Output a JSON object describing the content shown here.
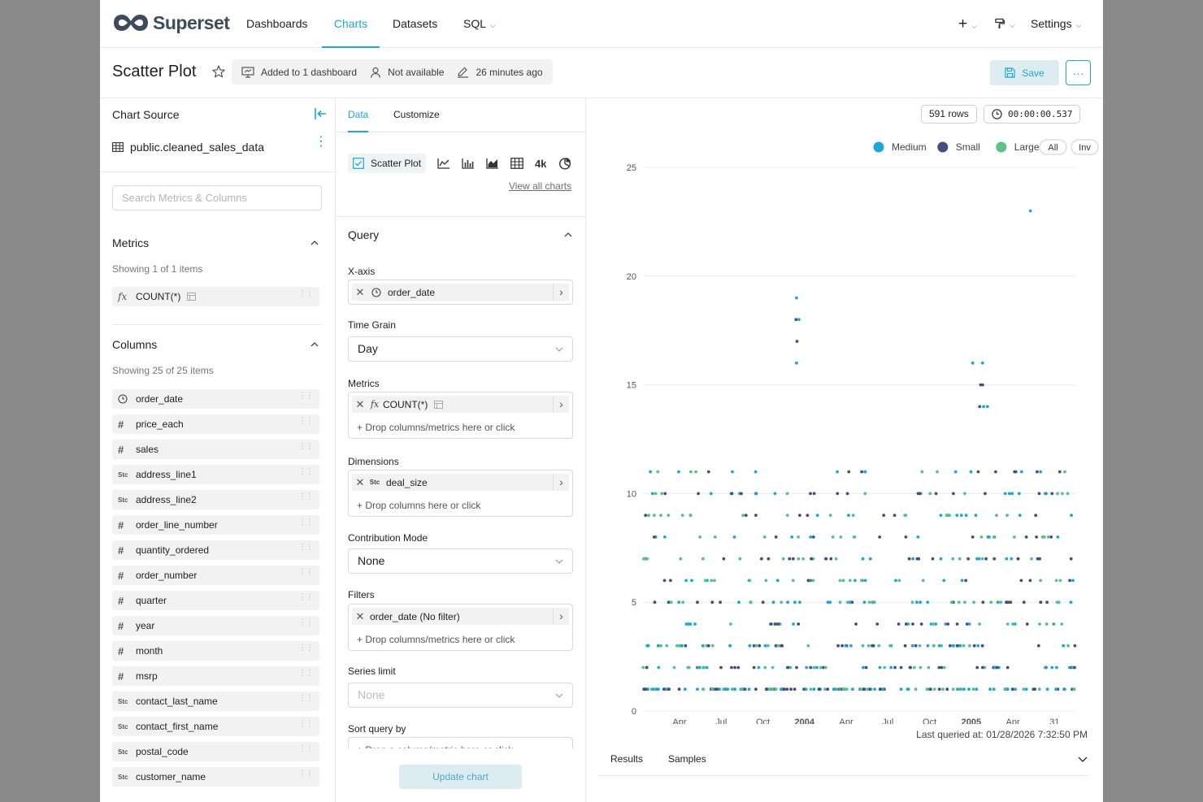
{
  "app": {
    "brand": "Superset",
    "accent": "#20a7c9"
  },
  "nav": {
    "items": [
      {
        "label": "Dashboards",
        "active": false
      },
      {
        "label": "Charts",
        "active": true
      },
      {
        "label": "Datasets",
        "active": false
      },
      {
        "label": "SQL",
        "active": false
      }
    ],
    "settings_label": "Settings"
  },
  "header": {
    "title": "Scatter Plot",
    "meta": {
      "dashboards": "Added to 1 dashboard",
      "owner": "Not available",
      "modified": "26 minutes ago"
    },
    "save_label": "Save",
    "more_label": "···"
  },
  "left": {
    "source_label": "Chart Source",
    "dataset": "public.cleaned_sales_data",
    "search_placeholder": "Search Metrics & Columns",
    "metrics": {
      "title": "Metrics",
      "showing": "Showing 1 of 1 items",
      "items": [
        {
          "label": "COUNT(*)",
          "type": "fx"
        }
      ]
    },
    "columns": {
      "title": "Columns",
      "showing": "Showing 25 of 25 items",
      "items": [
        {
          "label": "order_date",
          "type": "time"
        },
        {
          "label": "price_each",
          "type": "num"
        },
        {
          "label": "sales",
          "type": "num"
        },
        {
          "label": "address_line1",
          "type": "str"
        },
        {
          "label": "address_line2",
          "type": "str"
        },
        {
          "label": "order_line_number",
          "type": "num"
        },
        {
          "label": "quantity_ordered",
          "type": "num"
        },
        {
          "label": "order_number",
          "type": "num"
        },
        {
          "label": "quarter",
          "type": "num"
        },
        {
          "label": "year",
          "type": "num"
        },
        {
          "label": "month",
          "type": "num"
        },
        {
          "label": "msrp",
          "type": "num"
        },
        {
          "label": "contact_last_name",
          "type": "str"
        },
        {
          "label": "contact_first_name",
          "type": "str"
        },
        {
          "label": "postal_code",
          "type": "str"
        },
        {
          "label": "customer_name",
          "type": "str"
        }
      ]
    }
  },
  "middle": {
    "tabs": [
      {
        "label": "Data",
        "active": true
      },
      {
        "label": "Customize",
        "active": false
      }
    ],
    "viz_type": "Scatter Plot",
    "big_number_glyph": "4k",
    "view_all": "View all charts",
    "query_title": "Query",
    "x_axis": {
      "label": "X-axis",
      "value": "order_date"
    },
    "time_grain": {
      "label": "Time Grain",
      "value": "Day"
    },
    "metrics": {
      "label": "Metrics",
      "value": "COUNT(*)",
      "drop": "Drop columns/metrics here or click"
    },
    "dimensions": {
      "label": "Dimensions",
      "value": "deal_size",
      "drop": "Drop columns here or click"
    },
    "contribution": {
      "label": "Contribution Mode",
      "value": "None"
    },
    "filters": {
      "label": "Filters",
      "value": "order_date (No filter)",
      "drop": "Drop columns/metrics here or click"
    },
    "series_limit": {
      "label": "Series limit",
      "value": "None"
    },
    "sort_by": {
      "label": "Sort query by",
      "drop": "Drop a column/metric here or click"
    },
    "update_label": "Update chart"
  },
  "right": {
    "rows": "591 rows",
    "duration": "00:00:00.537",
    "last_queried": "Last queried at: 01/28/2026 7:32:50 PM",
    "bottom_tabs": [
      "Results",
      "Samples"
    ]
  },
  "chart_data": {
    "type": "scatter",
    "title": "",
    "xlabel": "",
    "ylabel": "",
    "ylim": [
      0,
      25
    ],
    "y_ticks": [
      0,
      5,
      10,
      15,
      20,
      25
    ],
    "x_ticks": [
      "Apr",
      "Jul",
      "Oct",
      "2004",
      "Apr",
      "Jul",
      "Oct",
      "2005",
      "Apr",
      "31"
    ],
    "x_range": [
      "2003-01-06",
      "2005-05-31"
    ],
    "grid": true,
    "legend_position": "top-right",
    "legend_controls": [
      "All",
      "Inv"
    ],
    "series": [
      {
        "name": "Medium",
        "color": "#1ea7d4"
      },
      {
        "name": "Small",
        "color": "#454e7c"
      },
      {
        "name": "Large",
        "color": "#5ac189"
      }
    ],
    "notable_points": [
      {
        "series": "Medium",
        "x": "2005-03-01",
        "y": 23
      },
      {
        "series": "Medium",
        "x": "2003-11-13",
        "y": 19
      },
      {
        "series": "Small",
        "x": "2003-11-12",
        "y": 18
      },
      {
        "series": "Medium",
        "x": "2003-11-18",
        "y": 18
      },
      {
        "series": "Small",
        "x": "2003-11-14",
        "y": 17
      },
      {
        "series": "Medium",
        "x": "2003-11-13",
        "y": 16
      },
      {
        "series": "Medium",
        "x": "2004-11-04",
        "y": 16
      },
      {
        "series": "Medium",
        "x": "2004-11-24",
        "y": 16
      },
      {
        "series": "Small",
        "x": "2004-11-20",
        "y": 15
      },
      {
        "series": "Small",
        "x": "2004-11-24",
        "y": 15
      },
      {
        "series": "Medium",
        "x": "2004-11-26",
        "y": 14
      },
      {
        "series": "Small",
        "x": "2004-11-18",
        "y": 14
      },
      {
        "series": "Medium",
        "x": "2004-12-04",
        "y": 14
      }
    ],
    "value_range_bulk": [
      1,
      11
    ],
    "total_rows": 591
  }
}
